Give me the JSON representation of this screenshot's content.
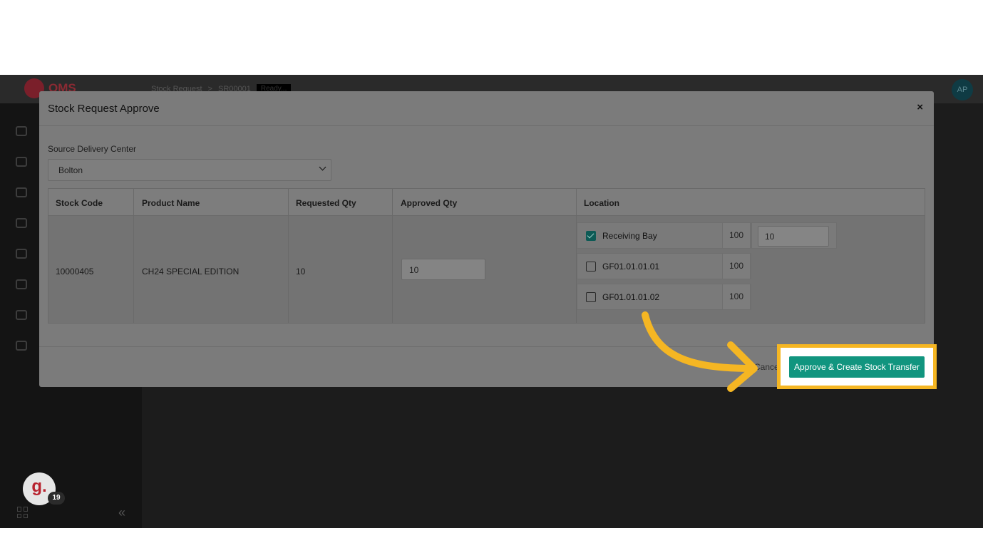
{
  "app": {
    "logo_text": "OMS",
    "breadcrumb": [
      "Stock Request",
      ">",
      "SR00001",
      "Ready..."
    ],
    "user_initials": "AP",
    "guide_avatar_letter": "g.",
    "guide_badge_count": "19",
    "collapse_glyph": "«"
  },
  "modal": {
    "title": "Stock Request Approve",
    "close_label": "×",
    "source_label": "Source Delivery Center",
    "source_value": "Bolton",
    "table": {
      "headers": [
        "Stock Code",
        "Product Name",
        "Requested Qty",
        "Approved Qty",
        "Location"
      ],
      "row": {
        "stock_code": "10000405",
        "product_name": "CH24 SPECIAL EDITION",
        "requested_qty": "10",
        "approved_qty": "10"
      },
      "locations": [
        {
          "name": "Receiving Bay",
          "qty": "100",
          "checked": true,
          "input": "10"
        },
        {
          "name": "GF01.01.01.01",
          "qty": "100",
          "checked": false
        },
        {
          "name": "GF01.01.01.02",
          "qty": "100",
          "checked": false
        }
      ]
    },
    "cancel_label": "Cancel",
    "approve_label": "Approve & Create Stock Transfer"
  },
  "colors": {
    "highlight": "#f5b623",
    "approve_button": "#11957f",
    "overlay": "#1c1c1c"
  }
}
